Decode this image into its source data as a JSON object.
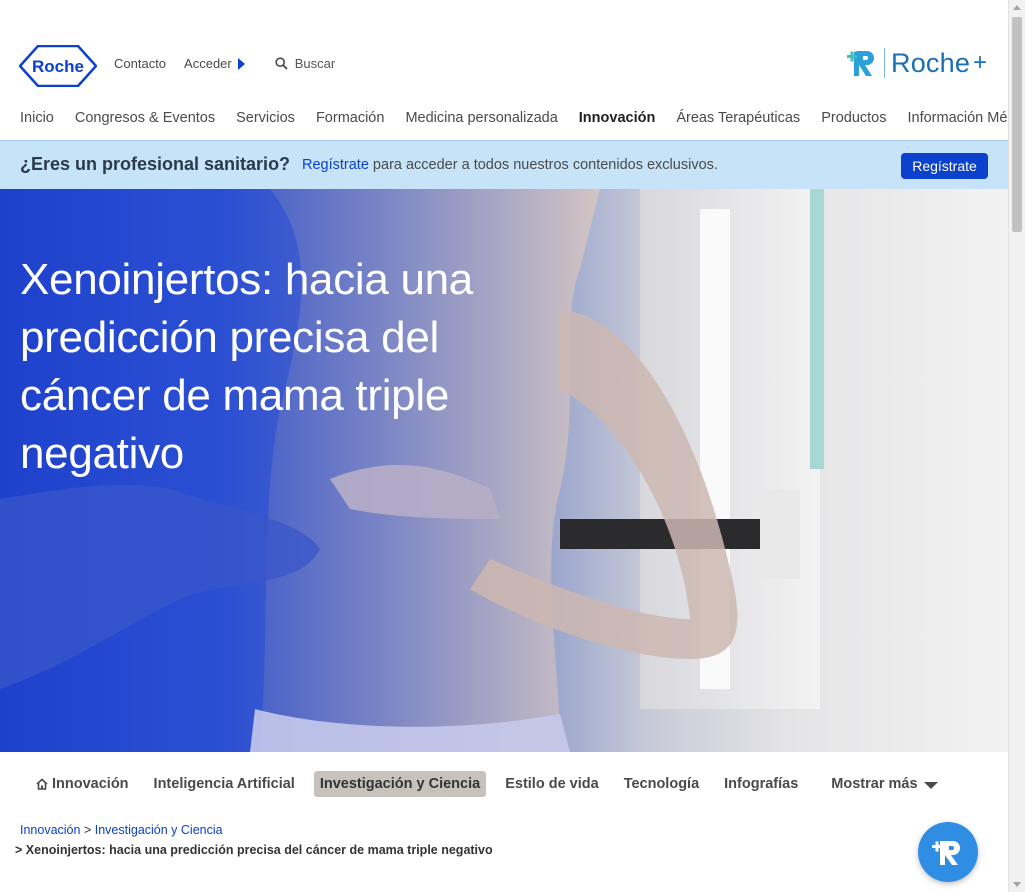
{
  "header": {
    "logo_text": "Roche",
    "contact_label": "Contacto",
    "login_label": "Acceder",
    "search_placeholder": "Buscar",
    "roche_plus_text": "Roche",
    "roche_plus_suffix": "+"
  },
  "main_nav": {
    "items": [
      {
        "label": "Inicio"
      },
      {
        "label": "Congresos & Eventos"
      },
      {
        "label": "Servicios"
      },
      {
        "label": "Formación"
      },
      {
        "label": "Medicina personalizada"
      },
      {
        "label": "Innovación"
      },
      {
        "label": "Áreas Terapéuticas"
      },
      {
        "label": "Productos"
      },
      {
        "label": "Información Médica"
      }
    ],
    "active": "Innovación"
  },
  "register_band": {
    "question": "¿Eres un profesional sanitario?",
    "link_text": "Regístrate",
    "rest_text": " para acceder a todos nuestros contenidos exclusivos.",
    "button_label": "Regístrate"
  },
  "hero": {
    "title": "Xenoinjertos: hacia una predicción precisa del cáncer de mama triple negativo"
  },
  "sub_nav": {
    "items": [
      {
        "label": "Innovación"
      },
      {
        "label": "Inteligencia Artificial"
      },
      {
        "label": "Investigación y Ciencia"
      },
      {
        "label": "Estilo de vida"
      },
      {
        "label": "Tecnología"
      },
      {
        "label": "Infografías"
      }
    ],
    "active": "Investigación y Ciencia",
    "show_more_label": "Mostrar más"
  },
  "breadcrumb": {
    "items": [
      "Innovación",
      "Investigación y Ciencia"
    ],
    "separator": ">",
    "current": "Xenoinjertos: hacia una predicción precisa del cáncer de mama triple negativo"
  },
  "colors": {
    "brand_blue": "#0b41cd",
    "band_bg": "#c7e3f8",
    "roche_plus_blue": "#1a6fb5",
    "fab_blue": "#2f8de4"
  }
}
